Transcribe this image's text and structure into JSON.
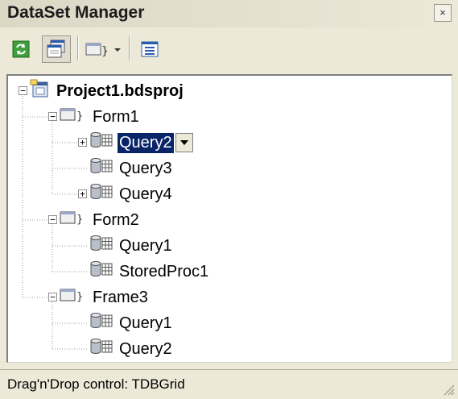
{
  "window": {
    "title": "DataSet Manager",
    "close_glyph": "×"
  },
  "toolbar": {
    "buttons": [
      {
        "icon": "refresh-icon"
      },
      {
        "icon": "view-windows-icon",
        "pressed": true
      },
      {
        "icon": "form-dropdown-icon"
      },
      {
        "icon": "list-view-icon"
      }
    ]
  },
  "tree": {
    "nodes": [
      {
        "label": "Project1.bdsproj",
        "icon": "project-icon",
        "depth": 0,
        "expander": "minus"
      },
      {
        "label": "Form1",
        "icon": "form-icon",
        "depth": 1,
        "expander": "minus"
      },
      {
        "label": "Query2",
        "icon": "dataset-icon",
        "depth": 2,
        "expander": "plus",
        "selected": true,
        "has_dropdown": true
      },
      {
        "label": "Query3",
        "icon": "dataset-icon",
        "depth": 2,
        "expander": "none"
      },
      {
        "label": "Query4",
        "icon": "dataset-icon",
        "depth": 2,
        "expander": "plus"
      },
      {
        "label": "Form2",
        "icon": "form-icon",
        "depth": 1,
        "expander": "minus"
      },
      {
        "label": "Query1",
        "icon": "dataset-icon",
        "depth": 2,
        "expander": "none"
      },
      {
        "label": "StoredProc1",
        "icon": "dataset-icon",
        "depth": 2,
        "expander": "none"
      },
      {
        "label": "Frame3",
        "icon": "form-icon",
        "depth": 1,
        "expander": "minus"
      },
      {
        "label": "Query1",
        "icon": "dataset-icon",
        "depth": 2,
        "expander": "none"
      },
      {
        "label": "Query2",
        "icon": "dataset-icon",
        "depth": 2,
        "expander": "none"
      }
    ]
  },
  "status": {
    "text": "Drag'n'Drop control: TDBGrid"
  },
  "colors": {
    "selection": "#0a246a",
    "window_bg": "#ece9d8",
    "tree_bg": "#ffffff"
  }
}
